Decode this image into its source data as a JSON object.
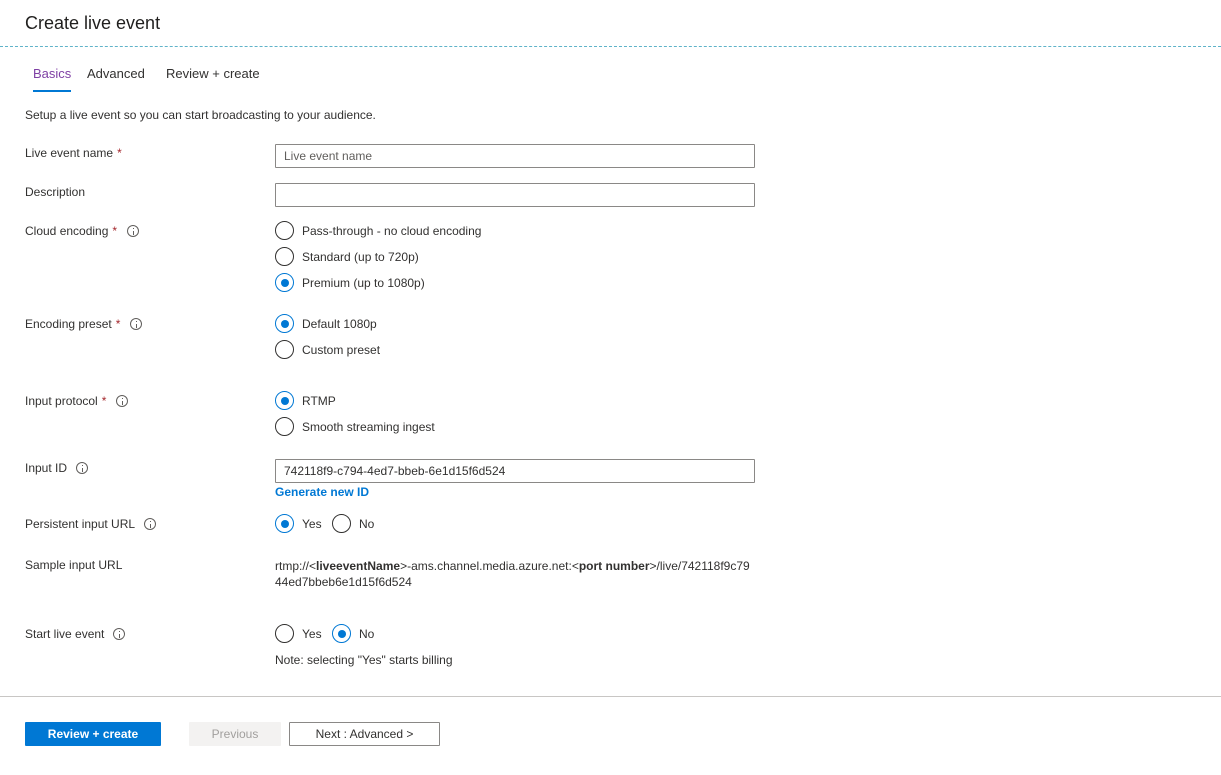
{
  "header": {
    "title": "Create live event"
  },
  "tabs": [
    {
      "label": "Basics",
      "active": true
    },
    {
      "label": "Advanced",
      "active": false
    },
    {
      "label": "Review + create",
      "active": false
    }
  ],
  "intro": "Setup a live event so you can start broadcasting to your audience.",
  "form": {
    "required_mark": "*",
    "live_event_name": {
      "label": "Live event name",
      "value": "",
      "placeholder": "Live event name"
    },
    "description": {
      "label": "Description",
      "value": ""
    },
    "cloud_encoding": {
      "label": "Cloud encoding",
      "options": [
        {
          "label": "Pass-through - no cloud encoding",
          "checked": false
        },
        {
          "label": "Standard (up to 720p)",
          "checked": false
        },
        {
          "label": "Premium (up to 1080p)",
          "checked": true
        }
      ]
    },
    "encoding_preset": {
      "label": "Encoding preset",
      "options": [
        {
          "label": "Default 1080p",
          "checked": true
        },
        {
          "label": "Custom preset",
          "checked": false
        }
      ]
    },
    "input_protocol": {
      "label": "Input protocol",
      "options": [
        {
          "label": "RTMP",
          "checked": true
        },
        {
          "label": "Smooth streaming ingest",
          "checked": false
        }
      ]
    },
    "input_id": {
      "label": "Input ID",
      "value": "742118f9-c794-4ed7-bbeb-6e1d15f6d524",
      "link": "Generate new ID"
    },
    "persistent_input_url": {
      "label": "Persistent input URL",
      "options": [
        {
          "label": "Yes",
          "checked": true
        },
        {
          "label": "No",
          "checked": false
        }
      ]
    },
    "sample_input_url": {
      "label": "Sample input URL",
      "prefix": "rtmp://<",
      "name_bold": "liveeventName",
      "middle": ">-ams.channel.media.azure.net:<",
      "port_bold": "port number",
      "suffix": ">/live/742118f9c7944ed7bbeb6e1d15f6d524"
    },
    "start_live_event": {
      "label": "Start live event",
      "options": [
        {
          "label": "Yes",
          "checked": false
        },
        {
          "label": "No",
          "checked": true
        }
      ],
      "note": "Note: selecting \"Yes\" starts billing"
    }
  },
  "footer": {
    "review_create": "Review + create",
    "previous": "Previous",
    "next": "Next : Advanced >"
  },
  "colors": {
    "accent": "#0078d4",
    "active_tab": "#7e3fa4",
    "required": "#a4262c"
  }
}
